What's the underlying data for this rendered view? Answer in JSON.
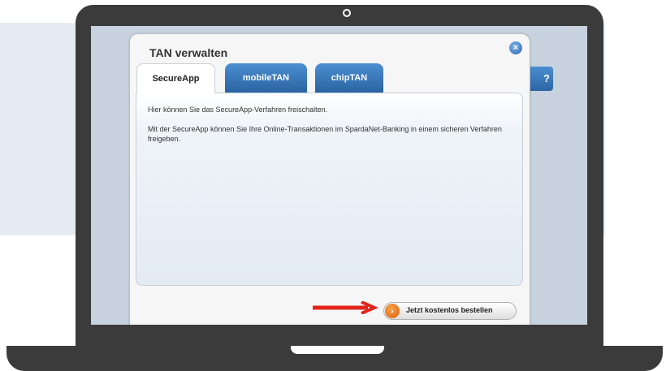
{
  "dialog": {
    "title": "TAN verwalten",
    "tabs": [
      {
        "label": "SecureApp",
        "active": true
      },
      {
        "label": "mobileTAN",
        "active": false
      },
      {
        "label": "chipTAN",
        "active": false
      }
    ],
    "paragraph1": "Hier können Sie das SecureApp-Verfahren freischalten.",
    "paragraph2": "Mit der SecureApp können Sie Ihre Online-Transaktionen im SpardaNet-Banking in einem sicheren Verfahren freigeben.",
    "order_button_label": "Jetzt kostenlos bestellen",
    "close_icon": "×",
    "order_icon": "›"
  },
  "help_button_label": "?",
  "colors": {
    "tab_blue": "#2f6db0",
    "order_orange": "#e9701a",
    "arrow_red": "#e0261b",
    "laptop": "#3b3b3b"
  }
}
